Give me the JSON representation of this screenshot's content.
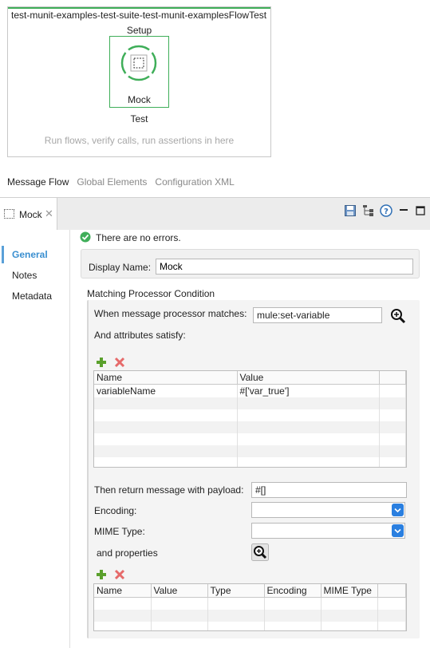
{
  "canvas": {
    "flow_title": "test-munit-examples-test-suite-test-munit-examplesFlowTest",
    "setup_label": "Setup",
    "mock_label": "Mock",
    "test_label": "Test",
    "hint": "Run flows, verify calls, run assertions in here",
    "accent_color": "#3fae59"
  },
  "editor_tabs": [
    {
      "label": "Message Flow",
      "active": true
    },
    {
      "label": "Global Elements",
      "active": false
    },
    {
      "label": "Configuration XML",
      "active": false
    }
  ],
  "properties": {
    "tab_label": "Mock",
    "toolbar_icons": [
      "save-icon",
      "tree-icon",
      "help-icon",
      "minimize-icon",
      "maximize-icon"
    ],
    "nav": [
      "General",
      "Notes",
      "Metadata"
    ],
    "status_text": "There are no errors.",
    "display_name_label": "Display Name:",
    "display_name_value": "Mock",
    "mpc_title": "Matching Processor Condition",
    "when_label": "When message processor matches:",
    "when_value": "mule:set-variable",
    "attrs_label": "And attributes satisfy:",
    "attr_table": {
      "headers": [
        "Name",
        "Value"
      ],
      "rows": [
        [
          "variableName",
          "#['var_true']"
        ]
      ]
    },
    "payload_label": "Then return message with payload:",
    "payload_value": "#[]",
    "encoding_label": "Encoding:",
    "encoding_value": "",
    "mime_label": "MIME Type:",
    "mime_value": "",
    "props_label": "and properties",
    "prop_table": {
      "headers": [
        "Name",
        "Value",
        "Type",
        "Encoding",
        "MIME Type"
      ]
    }
  }
}
